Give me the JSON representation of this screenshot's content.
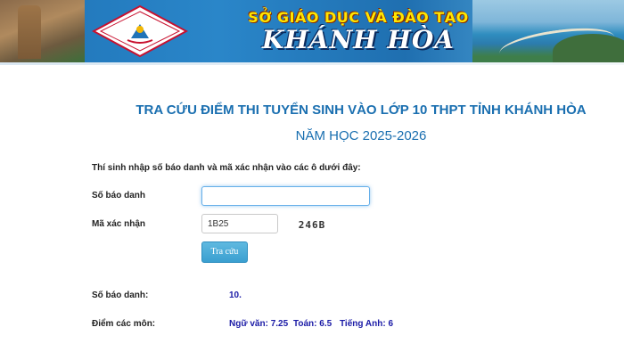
{
  "banner": {
    "logo_text": "SỞ GIÁO DỤC VÀ ĐÀO TẠO KHÁNH HÒA",
    "heading_top": "SỞ GIÁO DỤC VÀ ĐÀO TẠO",
    "heading_main": "KHÁNH HÒA"
  },
  "page": {
    "title": "TRA CỨU ĐIỂM THI TUYỂN SINH VÀO LỚP 10 THPT TỈNH KHÁNH HÒA",
    "subtitle": "NĂM HỌC 2025-2026",
    "instruction": "Thí sinh nhập số báo danh và mã xác nhận vào các ô dưới đây:"
  },
  "form": {
    "sbd_label": "Số báo danh",
    "sbd_value": "",
    "captcha_label": "Mã xác nhận",
    "captcha_value": "1B25",
    "captcha_image_text": "246B",
    "submit_label": "Tra cứu"
  },
  "result": {
    "sbd_label": "Số báo danh:",
    "sbd_value": "10.",
    "scores_label": "Điểm các môn:",
    "scores": [
      "Ngữ văn: 7.25",
      "Toán: 6.5",
      "Tiếng Anh: 6"
    ]
  },
  "colors": {
    "title_blue": "#1a6fb0",
    "button_blue": "#3a9fd0",
    "result_value_blue": "#1a1aa6",
    "banner_yellow": "#ffe600"
  }
}
